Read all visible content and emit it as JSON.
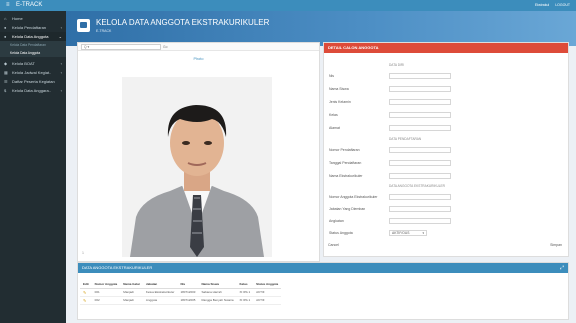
{
  "topbar": {
    "menu_icon": "menu-icon",
    "app_title": "E-TRACK",
    "right_user": "Ekstrakul",
    "right_logout": "LOGOUT"
  },
  "sidebar": {
    "items": [
      {
        "label": "Home",
        "icon": "home-icon"
      },
      {
        "label": "Kelola Pendaftaran",
        "icon": "user-icon"
      },
      {
        "label": "Kelola Data Anggota",
        "icon": "users-icon"
      },
      {
        "label": "Kelola BOAT",
        "icon": "boat-icon"
      },
      {
        "label": "Kelola Jadwal Kegiat..",
        "icon": "calendar-icon"
      },
      {
        "label": "Daftar Peserta Kegiatan",
        "icon": "list-icon"
      },
      {
        "label": "Kelola Data Anggara..",
        "icon": "dollar-icon"
      }
    ],
    "subitems": [
      "Kelola Data Pendaftaran",
      "Kelola Data Anggota"
    ]
  },
  "header": {
    "title": "KELOLA DATA ANGGOTA EKSTRAKURIKULER",
    "crumb": "E-TRACK"
  },
  "photo_panel": {
    "search_placeholder": "Q ▾",
    "go_label": "Go",
    "photo_label": "Photo",
    "footer": "1"
  },
  "form": {
    "title": "DETAIL CALON ANGGOTA",
    "section_data_diri": "DATA DIRI",
    "section_pendaftaran": "DATA PENDAFTARAN",
    "section_anggota": "DATA ANGGOTA EKSTRAKURIKULER",
    "labels": {
      "nis": "Nis",
      "nama": "Nama Siswa",
      "jk": "Jenis Kelamin",
      "kelas": "Kelas",
      "alamat": "Alamat",
      "no_daftar": "Nomor Pendaftaran",
      "tgl_daftar": "Tanggal Pendaftaran",
      "ekskul": "Nama Ekstrakurikuler",
      "no_anggota": "Nomor Anggota Ekstrakurikuler",
      "jabatan": "Jabatan Yang Diemban",
      "angkatan": "Angkatan",
      "status": "Status Anggota"
    },
    "status_value": "AKTIF/OUS",
    "cancel_label": "Cancel",
    "save_label": "Simpan"
  },
  "table": {
    "title": "DATA ANGGOTA EKSTRAKURIKULER",
    "columns": [
      "Edit",
      "Nomor Anggota",
      "Nama Gelar",
      "Jabatan",
      "Nis",
      "Nama Siswa",
      "Kelas",
      "Status Anggota"
    ],
    "rows": [
      [
        "✎",
        "001",
        "Manjadi",
        "Ketua Ekstrakurikuler",
        "180712003",
        "Sabana Harrah",
        "XI IPA 1",
        "AKTIF"
      ],
      [
        "✎",
        "002",
        "Manjadi",
        "Anggota",
        "180712005",
        "Rangga Benyah Notaria",
        "XI IPA 1",
        "AKTIF"
      ]
    ]
  },
  "colors": {
    "topbar": "#3c8dbc",
    "sidebar": "#222d32",
    "form_header": "#dd4b39",
    "table_header": "#3c8dbc"
  }
}
